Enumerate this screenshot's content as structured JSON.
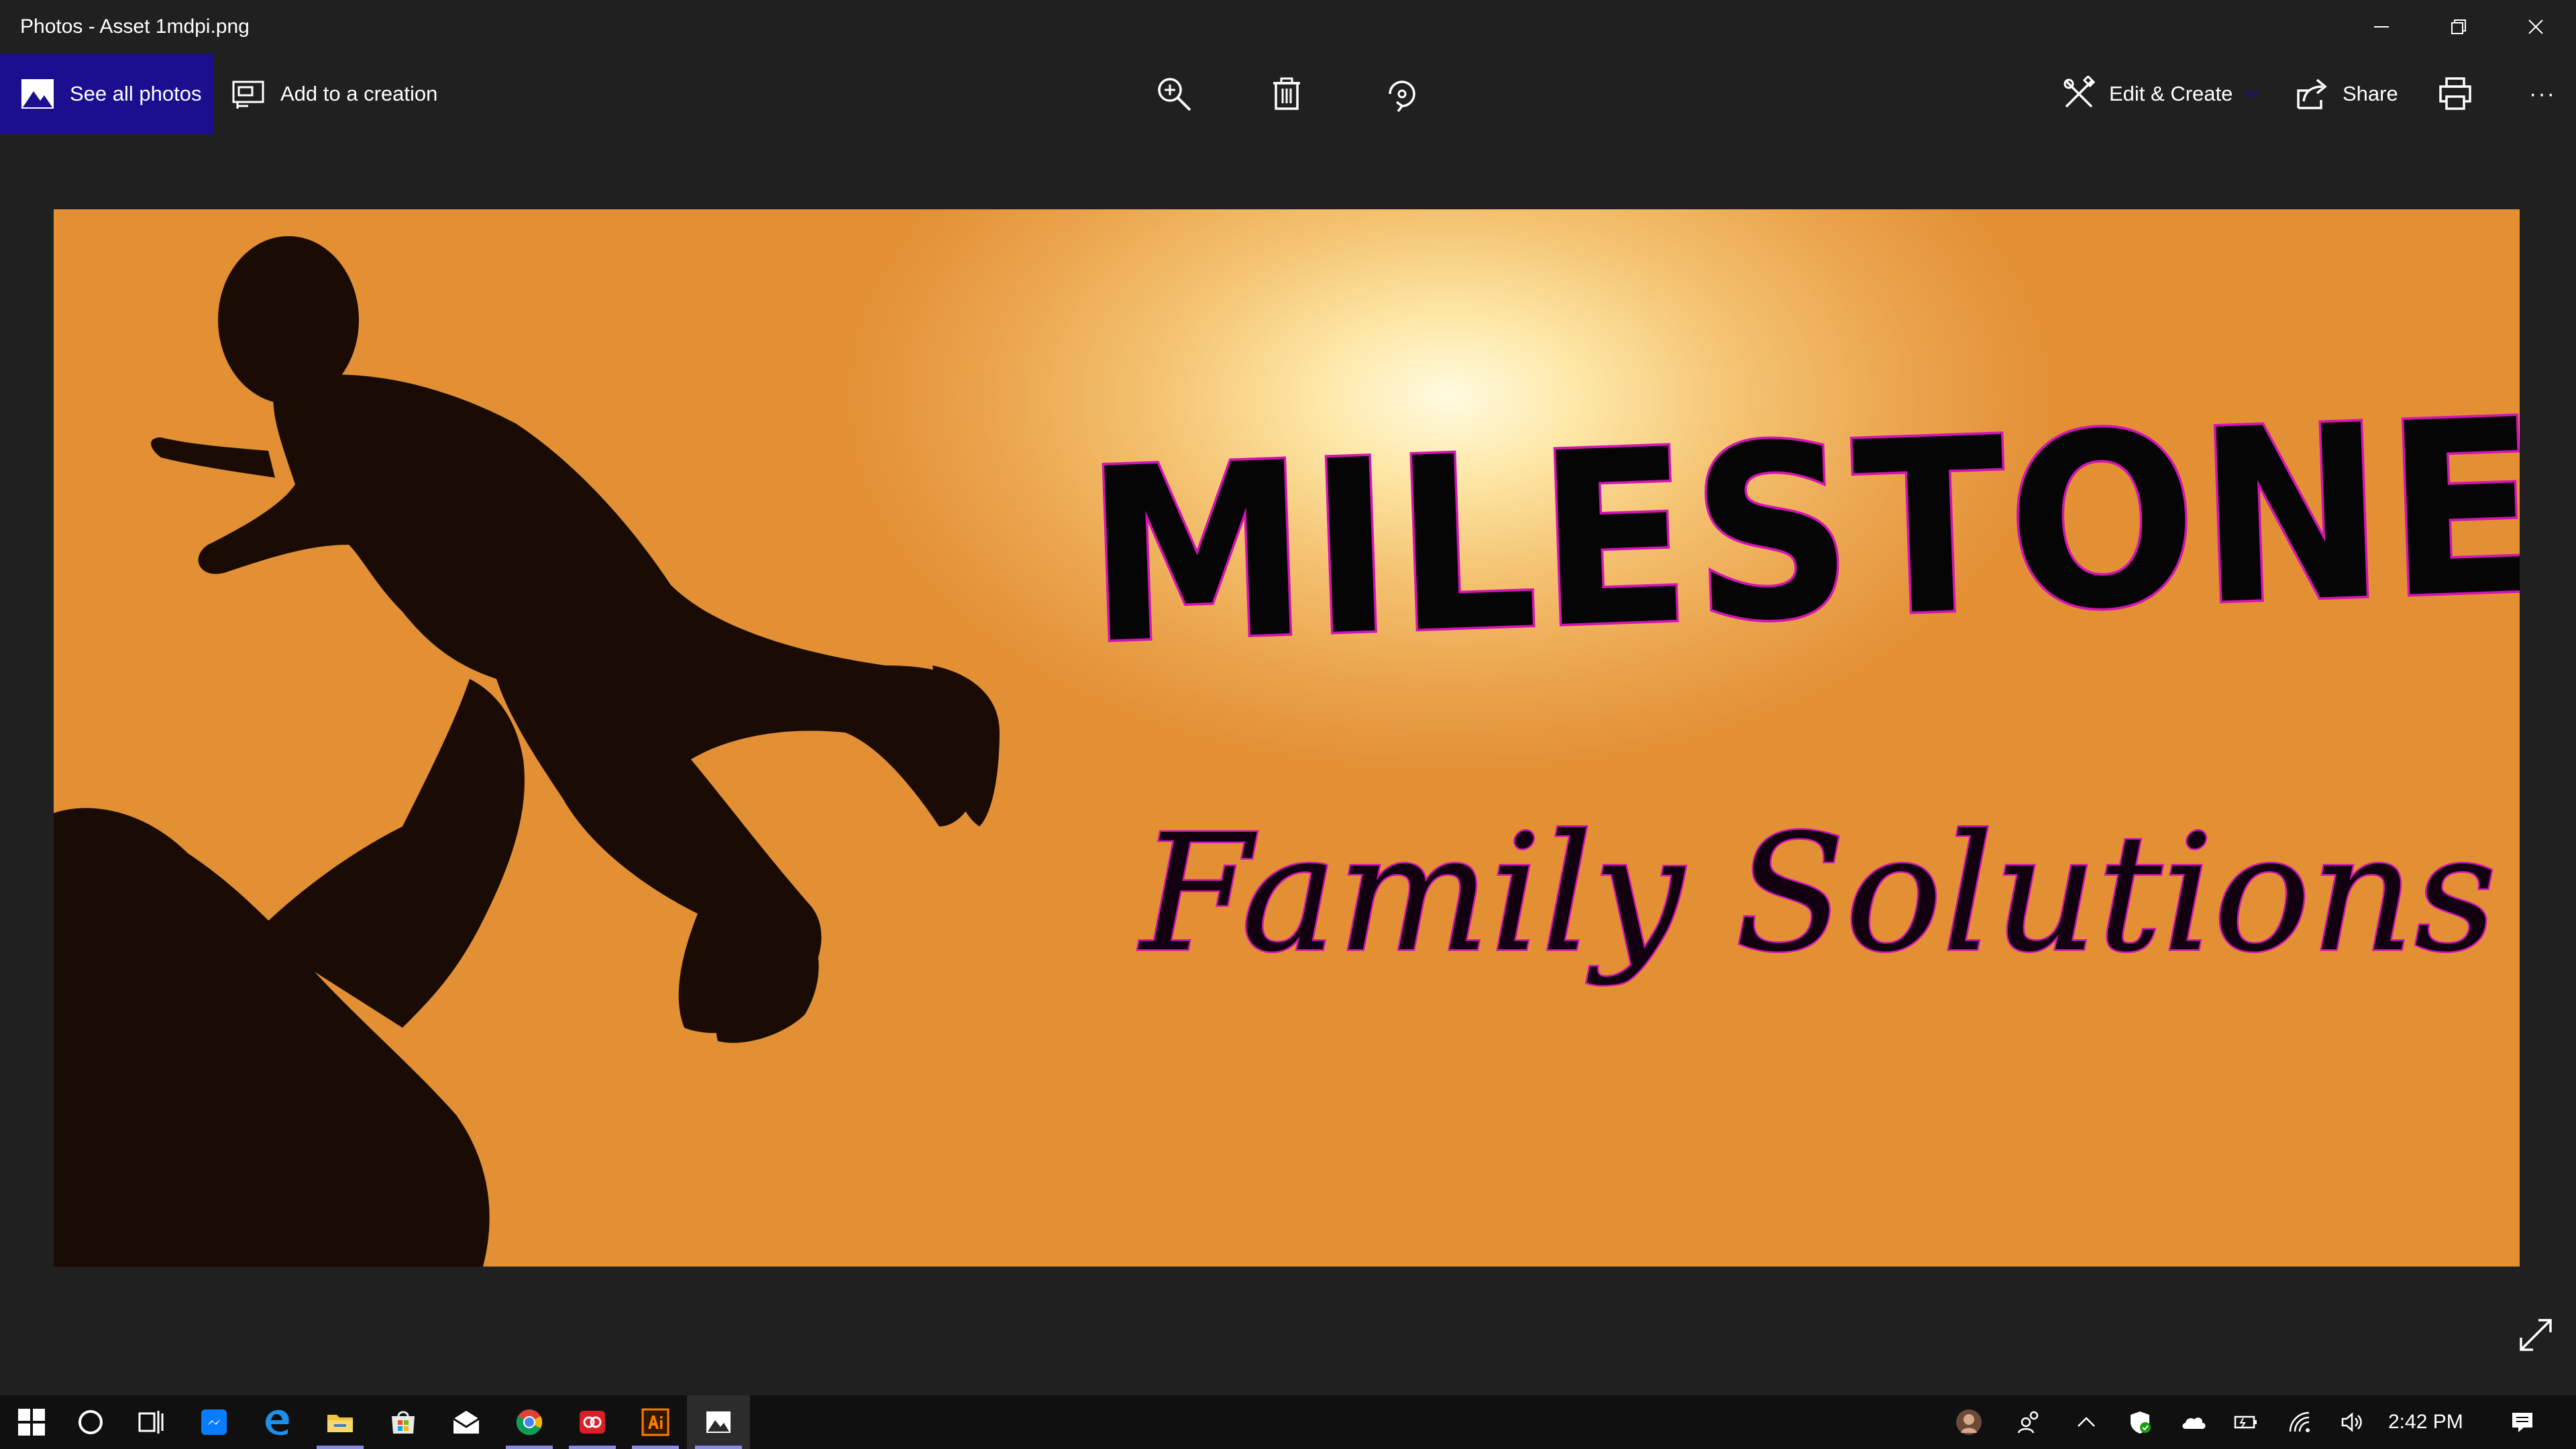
{
  "window": {
    "title": "Photos - Asset 1mdpi.png"
  },
  "toolbar": {
    "see_all_label": "See all photos",
    "add_creation_label": "Add to a creation",
    "edit_create_label": "Edit & Create",
    "share_label": "Share",
    "more_label": "···"
  },
  "image": {
    "brand_main": "MILESTONE",
    "brand_sub": "Family Solutions"
  },
  "taskbar": {
    "time": "2:42 PM"
  },
  "colors": {
    "accent": "#1b0f8f",
    "titlebar": "#202020",
    "taskbar": "#101010",
    "brand_outline": "#d214b5"
  },
  "icons": {
    "toolbar": [
      "photos-icon",
      "creation-icon",
      "zoom-in-icon",
      "trash-icon",
      "rotate-icon",
      "edit-create-icon",
      "share-icon",
      "print-icon",
      "more-icon"
    ],
    "taskbar": [
      "windows-start-icon",
      "search-circle-icon",
      "task-view-icon",
      "messenger-icon",
      "edge-icon",
      "file-explorer-icon",
      "store-icon",
      "mail-icon",
      "chrome-icon",
      "adobe-cc-icon",
      "illustrator-icon",
      "photos-app-icon"
    ],
    "tray": [
      "user-avatar",
      "people-icon",
      "chevron-up-icon",
      "defender-icon",
      "onedrive-icon",
      "battery-icon",
      "wifi-icon",
      "volume-icon",
      "notification-icon"
    ]
  }
}
